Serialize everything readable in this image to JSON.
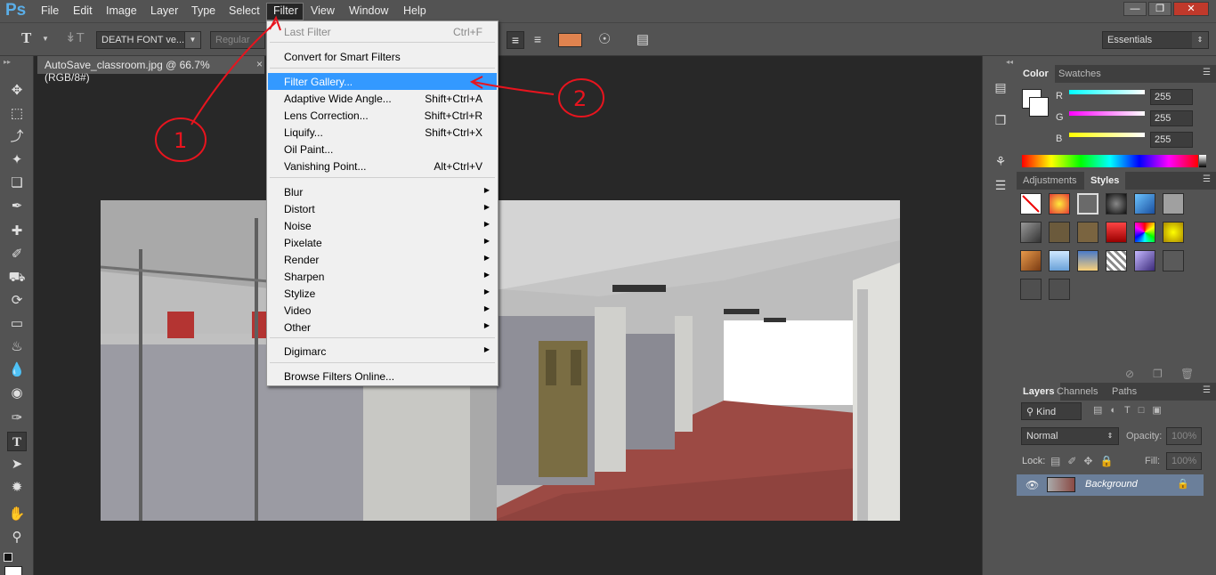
{
  "app": {
    "logo": "Ps",
    "menus": [
      "File",
      "Edit",
      "Image",
      "Layer",
      "Type",
      "Select",
      "Filter",
      "View",
      "Window",
      "Help"
    ],
    "active_menu": "Filter",
    "window_controls": [
      "minimize",
      "restore",
      "close"
    ]
  },
  "options_bar": {
    "font_family": "DEATH FONT ve...",
    "font_style": "Regular",
    "workspace": "Essentials",
    "text_color": "#e0834f"
  },
  "document": {
    "tab_title": "AutoSave_classroom.jpg @ 66.7% (RGB/8#)",
    "close": "×"
  },
  "filter_menu": {
    "items": [
      {
        "label": "Last Filter",
        "shortcut": "Ctrl+F",
        "disabled": true
      },
      {
        "separator": true
      },
      {
        "label": "Convert for Smart Filters"
      },
      {
        "separator": true
      },
      {
        "label": "Filter Gallery...",
        "highlighted": true
      },
      {
        "label": "Adaptive Wide Angle...",
        "shortcut": "Shift+Ctrl+A"
      },
      {
        "label": "Lens Correction...",
        "shortcut": "Shift+Ctrl+R"
      },
      {
        "label": "Liquify...",
        "shortcut": "Shift+Ctrl+X"
      },
      {
        "label": "Oil Paint..."
      },
      {
        "label": "Vanishing Point...",
        "shortcut": "Alt+Ctrl+V"
      },
      {
        "separator": true
      },
      {
        "label": "Blur",
        "submenu": true
      },
      {
        "label": "Distort",
        "submenu": true
      },
      {
        "label": "Noise",
        "submenu": true
      },
      {
        "label": "Pixelate",
        "submenu": true
      },
      {
        "label": "Render",
        "submenu": true
      },
      {
        "label": "Sharpen",
        "submenu": true
      },
      {
        "label": "Stylize",
        "submenu": true
      },
      {
        "label": "Video",
        "submenu": true
      },
      {
        "label": "Other",
        "submenu": true
      },
      {
        "separator": true
      },
      {
        "label": "Digimarc",
        "submenu": true
      },
      {
        "separator": true
      },
      {
        "label": "Browse Filters Online..."
      }
    ]
  },
  "color_panel": {
    "tabs": [
      "Color",
      "Swatches"
    ],
    "active_tab": "Color",
    "channels": [
      {
        "label": "R",
        "value": "255",
        "color": "#00ffff"
      },
      {
        "label": "G",
        "value": "255",
        "color": "#ff00ff"
      },
      {
        "label": "B",
        "value": "255",
        "color": "#ffff00"
      }
    ]
  },
  "styles_panel": {
    "tabs": [
      "Adjustments",
      "Styles"
    ],
    "active_tab": "Styles"
  },
  "layers_panel": {
    "tabs": [
      "Layers",
      "Channels",
      "Paths"
    ],
    "active_tab": "Layers",
    "filter_kind": "Kind",
    "blend_mode": "Normal",
    "opacity_label": "Opacity:",
    "opacity_value": "100%",
    "lock_label": "Lock:",
    "fill_label": "Fill:",
    "fill_value": "100%",
    "layers": [
      {
        "name": "Background",
        "locked": true,
        "visible": true
      }
    ]
  },
  "annotations": {
    "step1": "1",
    "step2": "2",
    "color": "#e8141e"
  }
}
